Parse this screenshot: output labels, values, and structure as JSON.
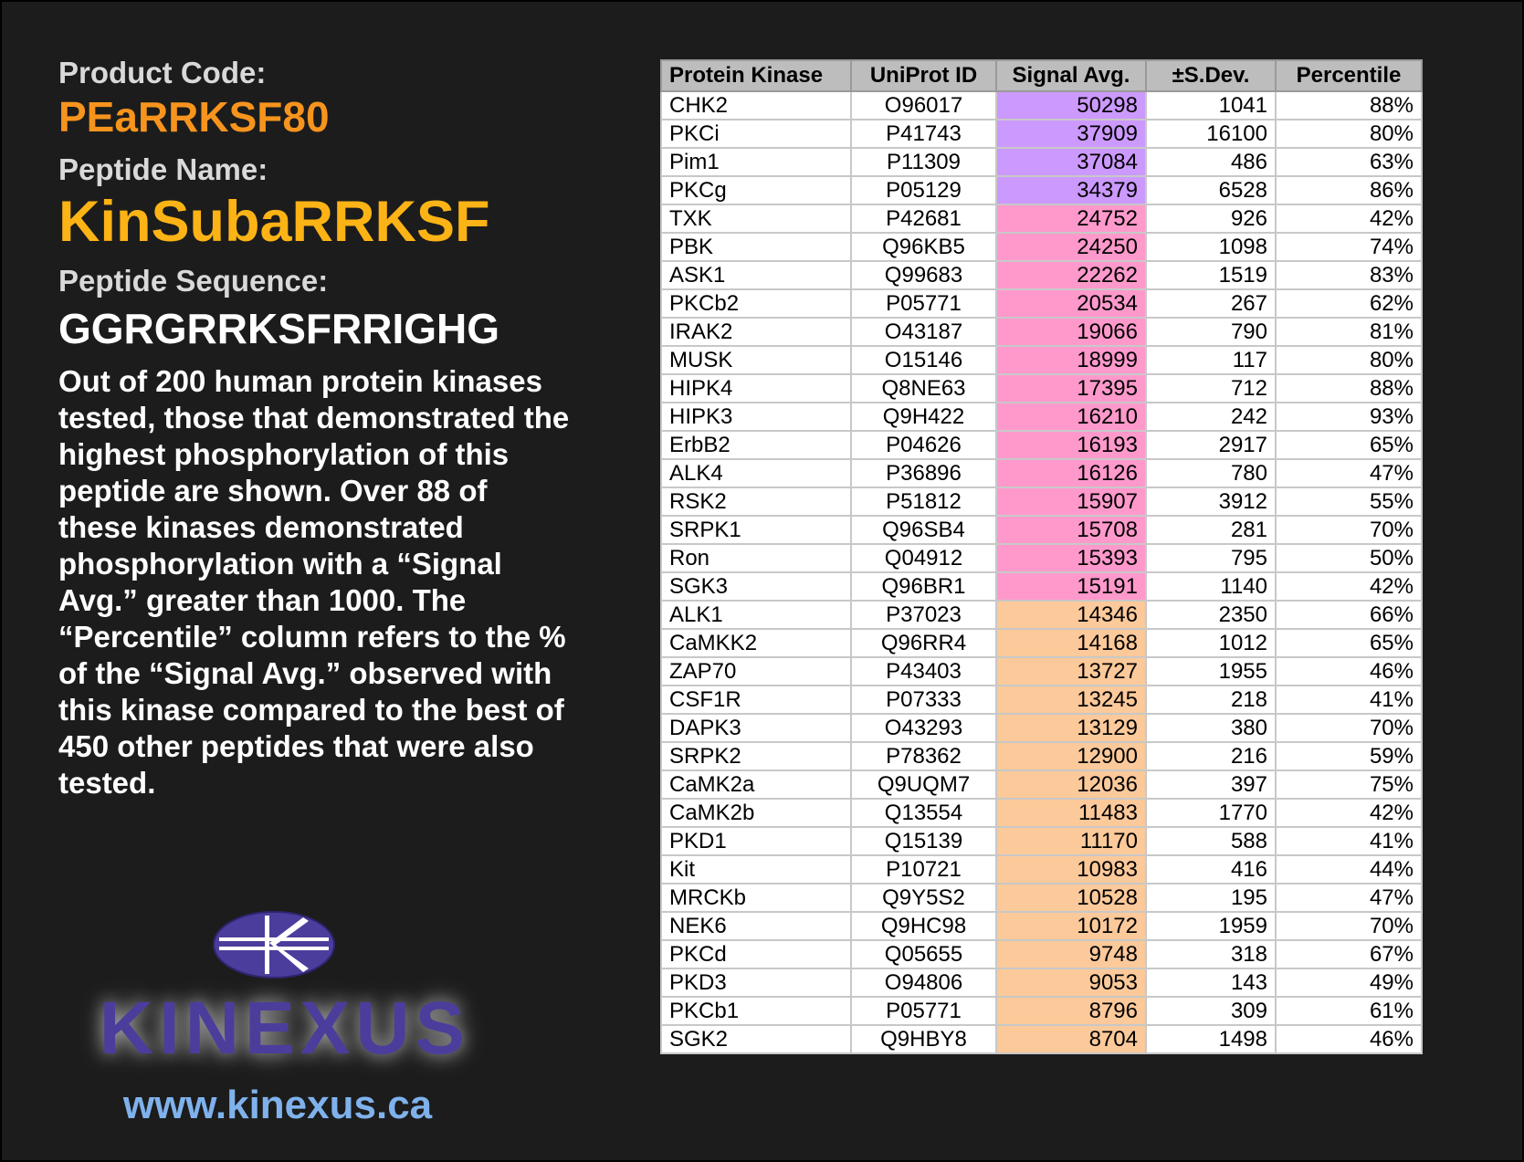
{
  "product_code_label": "Product Code:",
  "product_code": "PEaRRKSF80",
  "peptide_name_label": "Peptide Name:",
  "peptide_name": "KinSubaRRKSF",
  "peptide_sequence_label": "Peptide Sequence:",
  "peptide_sequence": "GGRGRRKSFRRIGHG",
  "description": "Out of 200 human protein kinases tested, those that demonstrated the highest phosphorylation of this peptide are shown. Over 88 of these kinases demonstrated phosphorylation with a “Signal Avg.” greater than 1000. The “Percentile” column refers to the % of the “Signal Avg.” observed with this kinase compared to the best of 450 other peptides that were also tested.",
  "logo_text": "KINEXUS",
  "website": "www.kinexus.ca",
  "colors": {
    "product_code": "#f7941d",
    "peptide_name": "#fcb315",
    "signal_purple": "#cc99ff",
    "signal_pink": "#ff99cc",
    "signal_peach": "#fcc99a",
    "logo_purple": "#4b3d9c",
    "url_blue": "#7fb2ec"
  },
  "table": {
    "headers": [
      "Protein Kinase",
      "UniProt ID",
      "Signal Avg.",
      "±S.Dev.",
      "Percentile"
    ],
    "rows": [
      {
        "kinase": "CHK2",
        "uniprot": "O96017",
        "signal": "50298",
        "sdev": "1041",
        "pct": "88%",
        "tier": "purple"
      },
      {
        "kinase": "PKCi",
        "uniprot": "P41743",
        "signal": "37909",
        "sdev": "16100",
        "pct": "80%",
        "tier": "purple"
      },
      {
        "kinase": "Pim1",
        "uniprot": "P11309",
        "signal": "37084",
        "sdev": "486",
        "pct": "63%",
        "tier": "purple"
      },
      {
        "kinase": "PKCg",
        "uniprot": "P05129",
        "signal": "34379",
        "sdev": "6528",
        "pct": "86%",
        "tier": "purple"
      },
      {
        "kinase": "TXK",
        "uniprot": "P42681",
        "signal": "24752",
        "sdev": "926",
        "pct": "42%",
        "tier": "pink"
      },
      {
        "kinase": "PBK",
        "uniprot": "Q96KB5",
        "signal": "24250",
        "sdev": "1098",
        "pct": "74%",
        "tier": "pink"
      },
      {
        "kinase": "ASK1",
        "uniprot": "Q99683",
        "signal": "22262",
        "sdev": "1519",
        "pct": "83%",
        "tier": "pink"
      },
      {
        "kinase": "PKCb2",
        "uniprot": "P05771",
        "signal": "20534",
        "sdev": "267",
        "pct": "62%",
        "tier": "pink"
      },
      {
        "kinase": "IRAK2",
        "uniprot": "O43187",
        "signal": "19066",
        "sdev": "790",
        "pct": "81%",
        "tier": "pink"
      },
      {
        "kinase": "MUSK",
        "uniprot": "O15146",
        "signal": "18999",
        "sdev": "117",
        "pct": "80%",
        "tier": "pink"
      },
      {
        "kinase": "HIPK4",
        "uniprot": "Q8NE63",
        "signal": "17395",
        "sdev": "712",
        "pct": "88%",
        "tier": "pink"
      },
      {
        "kinase": "HIPK3",
        "uniprot": "Q9H422",
        "signal": "16210",
        "sdev": "242",
        "pct": "93%",
        "tier": "pink"
      },
      {
        "kinase": "ErbB2",
        "uniprot": "P04626",
        "signal": "16193",
        "sdev": "2917",
        "pct": "65%",
        "tier": "pink"
      },
      {
        "kinase": "ALK4",
        "uniprot": "P36896",
        "signal": "16126",
        "sdev": "780",
        "pct": "47%",
        "tier": "pink"
      },
      {
        "kinase": "RSK2",
        "uniprot": "P51812",
        "signal": "15907",
        "sdev": "3912",
        "pct": "55%",
        "tier": "pink"
      },
      {
        "kinase": "SRPK1",
        "uniprot": "Q96SB4",
        "signal": "15708",
        "sdev": "281",
        "pct": "70%",
        "tier": "pink"
      },
      {
        "kinase": "Ron",
        "uniprot": "Q04912",
        "signal": "15393",
        "sdev": "795",
        "pct": "50%",
        "tier": "pink"
      },
      {
        "kinase": "SGK3",
        "uniprot": "Q96BR1",
        "signal": "15191",
        "sdev": "1140",
        "pct": "42%",
        "tier": "pink"
      },
      {
        "kinase": "ALK1",
        "uniprot": "P37023",
        "signal": "14346",
        "sdev": "2350",
        "pct": "66%",
        "tier": "peach"
      },
      {
        "kinase": "CaMKK2",
        "uniprot": "Q96RR4",
        "signal": "14168",
        "sdev": "1012",
        "pct": "65%",
        "tier": "peach"
      },
      {
        "kinase": "ZAP70",
        "uniprot": "P43403",
        "signal": "13727",
        "sdev": "1955",
        "pct": "46%",
        "tier": "peach"
      },
      {
        "kinase": "CSF1R",
        "uniprot": "P07333",
        "signal": "13245",
        "sdev": "218",
        "pct": "41%",
        "tier": "peach"
      },
      {
        "kinase": "DAPK3",
        "uniprot": "O43293",
        "signal": "13129",
        "sdev": "380",
        "pct": "70%",
        "tier": "peach"
      },
      {
        "kinase": "SRPK2",
        "uniprot": "P78362",
        "signal": "12900",
        "sdev": "216",
        "pct": "59%",
        "tier": "peach"
      },
      {
        "kinase": "CaMK2a",
        "uniprot": "Q9UQM7",
        "signal": "12036",
        "sdev": "397",
        "pct": "75%",
        "tier": "peach"
      },
      {
        "kinase": "CaMK2b",
        "uniprot": "Q13554",
        "signal": "11483",
        "sdev": "1770",
        "pct": "42%",
        "tier": "peach"
      },
      {
        "kinase": "PKD1",
        "uniprot": "Q15139",
        "signal": "11170",
        "sdev": "588",
        "pct": "41%",
        "tier": "peach"
      },
      {
        "kinase": "Kit",
        "uniprot": "P10721",
        "signal": "10983",
        "sdev": "416",
        "pct": "44%",
        "tier": "peach"
      },
      {
        "kinase": "MRCKb",
        "uniprot": "Q9Y5S2",
        "signal": "10528",
        "sdev": "195",
        "pct": "47%",
        "tier": "peach"
      },
      {
        "kinase": "NEK6",
        "uniprot": "Q9HC98",
        "signal": "10172",
        "sdev": "1959",
        "pct": "70%",
        "tier": "peach"
      },
      {
        "kinase": "PKCd",
        "uniprot": "Q05655",
        "signal": "9748",
        "sdev": "318",
        "pct": "67%",
        "tier": "peach"
      },
      {
        "kinase": "PKD3",
        "uniprot": "O94806",
        "signal": "9053",
        "sdev": "143",
        "pct": "49%",
        "tier": "peach"
      },
      {
        "kinase": "PKCb1",
        "uniprot": "P05771",
        "signal": "8796",
        "sdev": "309",
        "pct": "61%",
        "tier": "peach"
      },
      {
        "kinase": "SGK2",
        "uniprot": "Q9HBY8",
        "signal": "8704",
        "sdev": "1498",
        "pct": "46%",
        "tier": "peach"
      }
    ]
  }
}
